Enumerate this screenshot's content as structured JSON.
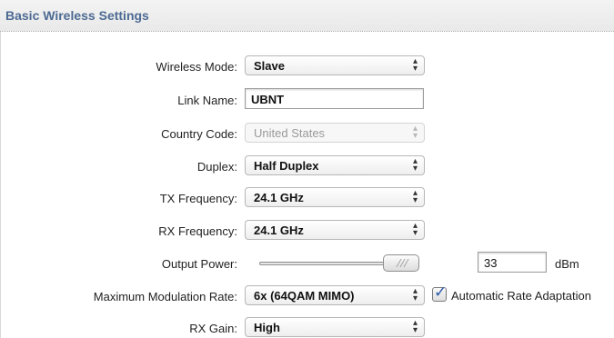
{
  "section": {
    "title": "Basic Wireless Settings"
  },
  "wireless_mode": {
    "label": "Wireless Mode:",
    "value": "Slave"
  },
  "link_name": {
    "label": "Link Name:",
    "value": "UBNT"
  },
  "country_code": {
    "label": "Country Code:",
    "value": "United States",
    "disabled": true
  },
  "duplex": {
    "label": "Duplex:",
    "value": "Half Duplex"
  },
  "tx_frequency": {
    "label": "TX Frequency:",
    "value": "24.1 GHz"
  },
  "rx_frequency": {
    "label": "RX Frequency:",
    "value": "24.1 GHz"
  },
  "output_power": {
    "label": "Output Power:",
    "value": "33",
    "unit": "dBm",
    "slider_level": 1.0
  },
  "max_modulation": {
    "label": "Maximum Modulation Rate:",
    "value": "6x (64QAM MIMO)",
    "auto_rate_label": "Automatic Rate Adaptation",
    "auto_rate_checked": true
  },
  "rx_gain": {
    "label": "RX Gain:",
    "value": "High"
  },
  "icons": {
    "select_arrows": "updown-chevron-icon",
    "slider_grip": "grip-icon",
    "check": "checkmark-icon"
  },
  "colors": {
    "title": "#4d6a93",
    "check": "#2b5aa8"
  }
}
